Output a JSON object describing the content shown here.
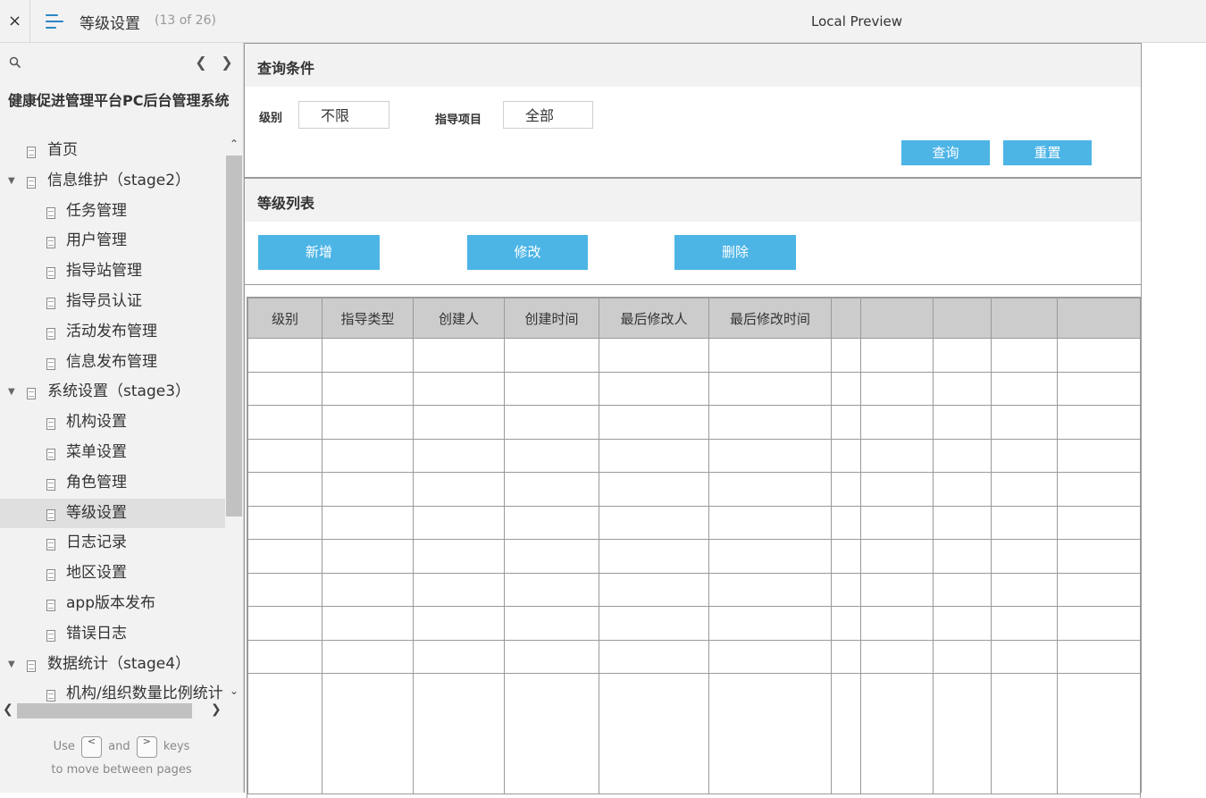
{
  "topbar": {
    "close_icon": "×",
    "title": "等级设置",
    "page_count": "(13 of 26)",
    "preview_label": "Local Preview"
  },
  "sidebar": {
    "project_title": "健康促进管理平台PC后台管理系统",
    "tree": [
      {
        "label": "首页",
        "level": 1
      },
      {
        "label": "信息维护（stage2）",
        "level": 1,
        "expanded": true
      },
      {
        "label": "任务管理",
        "level": 2
      },
      {
        "label": "用户管理",
        "level": 2
      },
      {
        "label": "指导站管理",
        "level": 2
      },
      {
        "label": "指导员认证",
        "level": 2
      },
      {
        "label": "活动发布管理",
        "level": 2
      },
      {
        "label": "信息发布管理",
        "level": 2
      },
      {
        "label": "系统设置（stage3）",
        "level": 1,
        "expanded": true
      },
      {
        "label": "机构设置",
        "level": 2
      },
      {
        "label": "菜单设置",
        "level": 2
      },
      {
        "label": "角色管理",
        "level": 2
      },
      {
        "label": "等级设置",
        "level": 2,
        "selected": true
      },
      {
        "label": "日志记录",
        "level": 2
      },
      {
        "label": "地区设置",
        "level": 2
      },
      {
        "label": "app版本发布",
        "level": 2
      },
      {
        "label": "错误日志",
        "level": 2
      },
      {
        "label": "数据统计（stage4）",
        "level": 1,
        "expanded": true
      },
      {
        "label": "机构/组织数量比例统计",
        "level": 2
      }
    ],
    "help": {
      "use": "Use",
      "prev_key": "<",
      "and": "and",
      "next_key": ">",
      "keys": "keys",
      "line2": "to move between pages"
    }
  },
  "query": {
    "title": "查询条件",
    "level_label": "级别",
    "level_value": "不限",
    "project_label": "指导项目",
    "project_value": "全部",
    "search_button": "查询",
    "reset_button": "重置"
  },
  "list": {
    "title": "等级列表",
    "add_button": "新增",
    "edit_button": "修改",
    "delete_button": "删除",
    "columns": [
      "级别",
      "指导类型",
      "创建人",
      "创建时间",
      "最后修改人",
      "最后修改时间",
      "",
      "",
      "",
      "",
      ""
    ],
    "row_count": 10
  },
  "colors": {
    "accent": "#4db5e6",
    "menu_icon": "#2b87c5",
    "header_bg": "#cccccc",
    "panel_bg": "#f2f2f2"
  }
}
